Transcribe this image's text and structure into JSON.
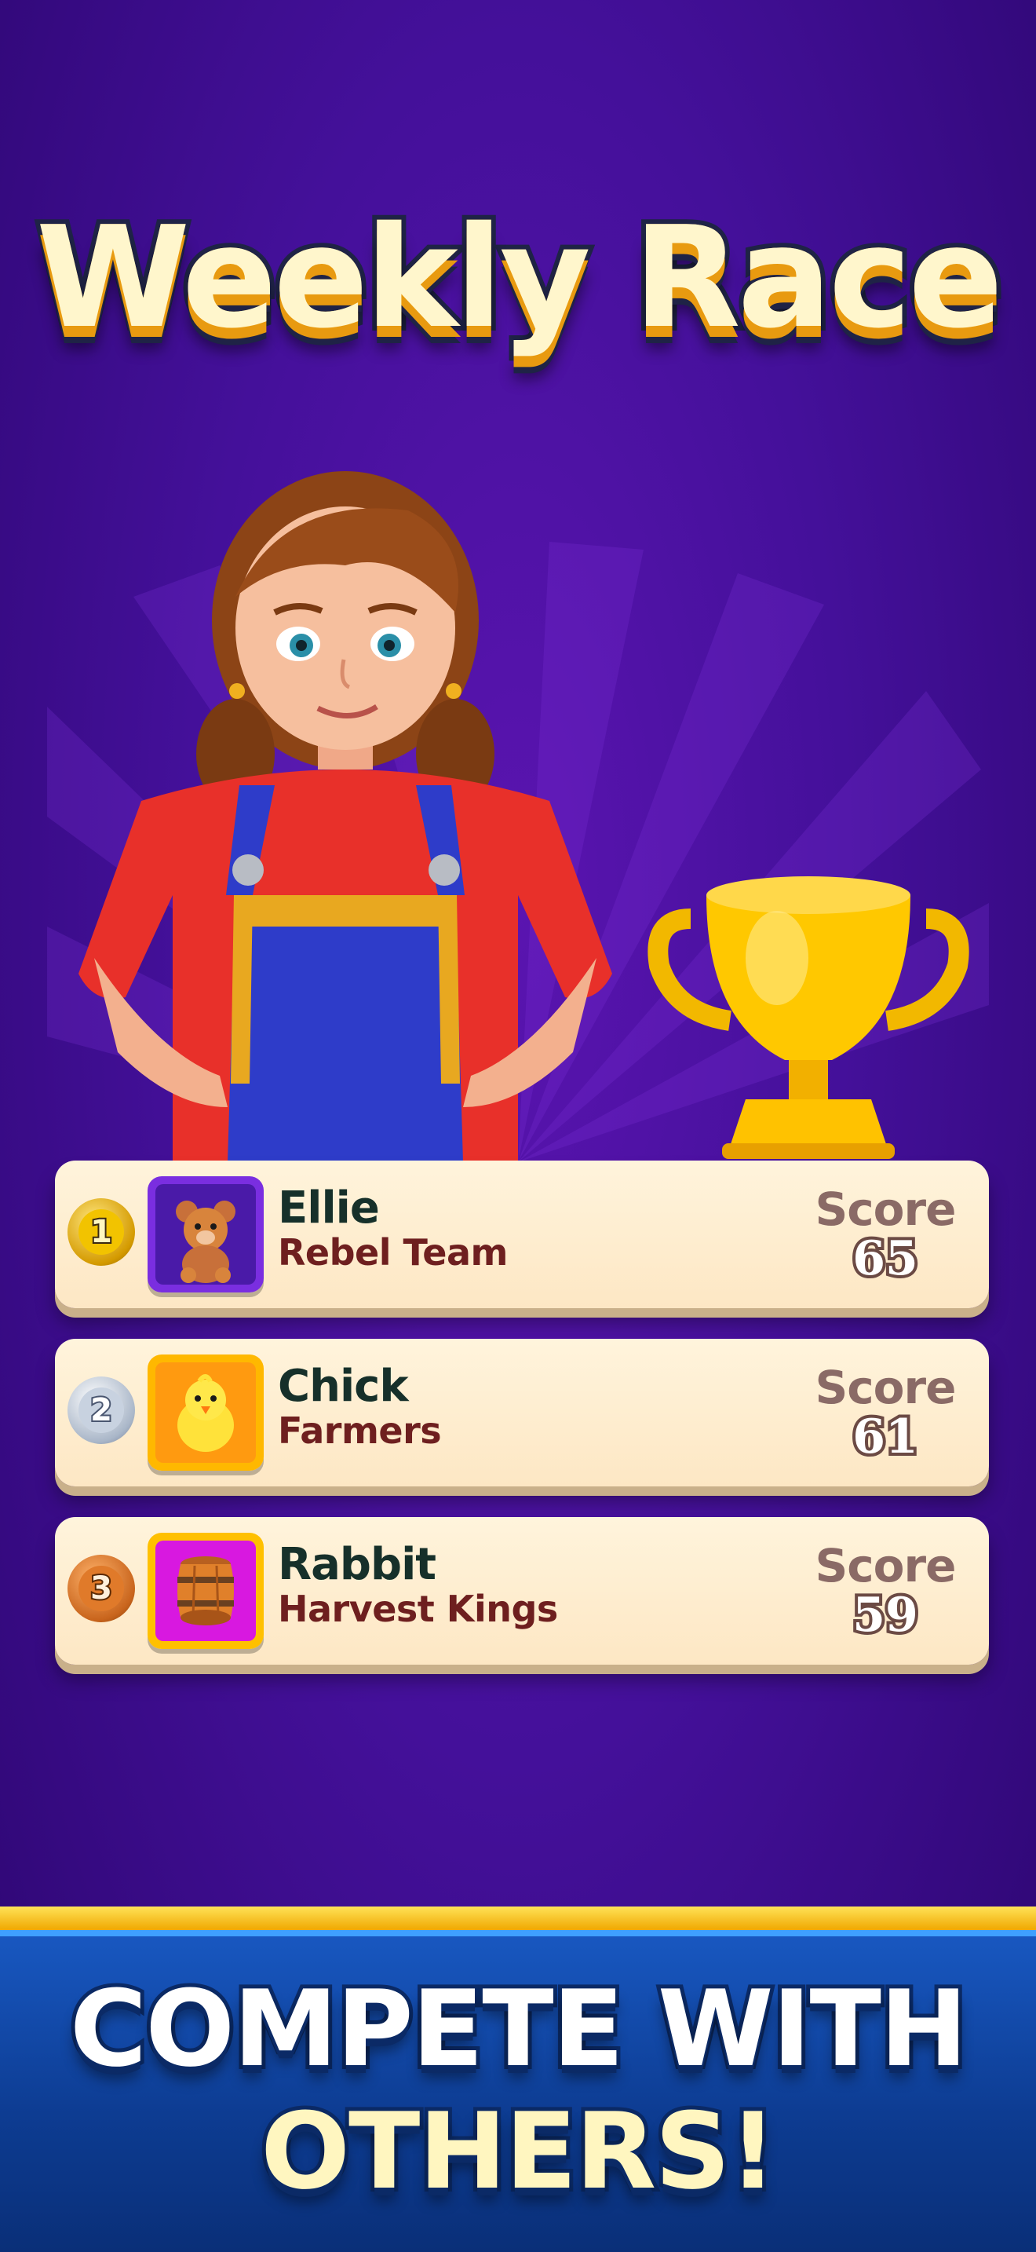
{
  "title": "Weekly Race",
  "leaderboard": [
    {
      "rank": "1",
      "medal": "gold-medal-icon",
      "avatar": "teddy-bear-icon",
      "name": "Ellie",
      "team": "Rebel Team",
      "score_label": "Score",
      "score": "65"
    },
    {
      "rank": "2",
      "medal": "silver-medal-icon",
      "avatar": "chick-icon",
      "name": "Chick",
      "team": "Farmers",
      "score_label": "Score",
      "score": "61"
    },
    {
      "rank": "3",
      "medal": "bronze-medal-icon",
      "avatar": "barrel-icon",
      "name": "Rabbit",
      "team": "Harvest Kings",
      "score_label": "Score",
      "score": "59"
    }
  ],
  "banner": {
    "line1": "COMPETE WITH",
    "line2": "OTHERS!"
  },
  "colors": {
    "background": "#44109a",
    "row": "#fff4dc",
    "banner": "#0d3c92",
    "gold": "#f2c300"
  }
}
